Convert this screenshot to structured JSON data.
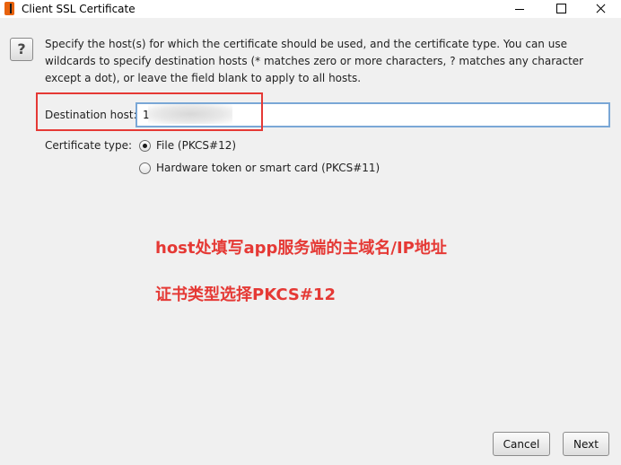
{
  "window": {
    "title": "Client SSL Certificate"
  },
  "help": {
    "icon_glyph": "?"
  },
  "description": "Specify the host(s) for which the certificate should be used, and the certificate type. You can use wildcards to specify destination hosts (* matches zero or more characters, ? matches any character except a dot), or leave the field blank to apply to all hosts.",
  "destination_host": {
    "label": "Destination host:",
    "value": "1"
  },
  "certificate_type": {
    "label": "Certificate type:",
    "options": [
      {
        "label": "File (PKCS#12)",
        "selected": true
      },
      {
        "label": "Hardware token or smart card (PKCS#11)",
        "selected": false
      }
    ]
  },
  "annotations": {
    "line1": "host处填写app服务端的主域名/IP地址",
    "line2": "证书类型选择PKCS#12",
    "color": "#e53935"
  },
  "buttons": {
    "cancel": "Cancel",
    "next": "Next"
  }
}
